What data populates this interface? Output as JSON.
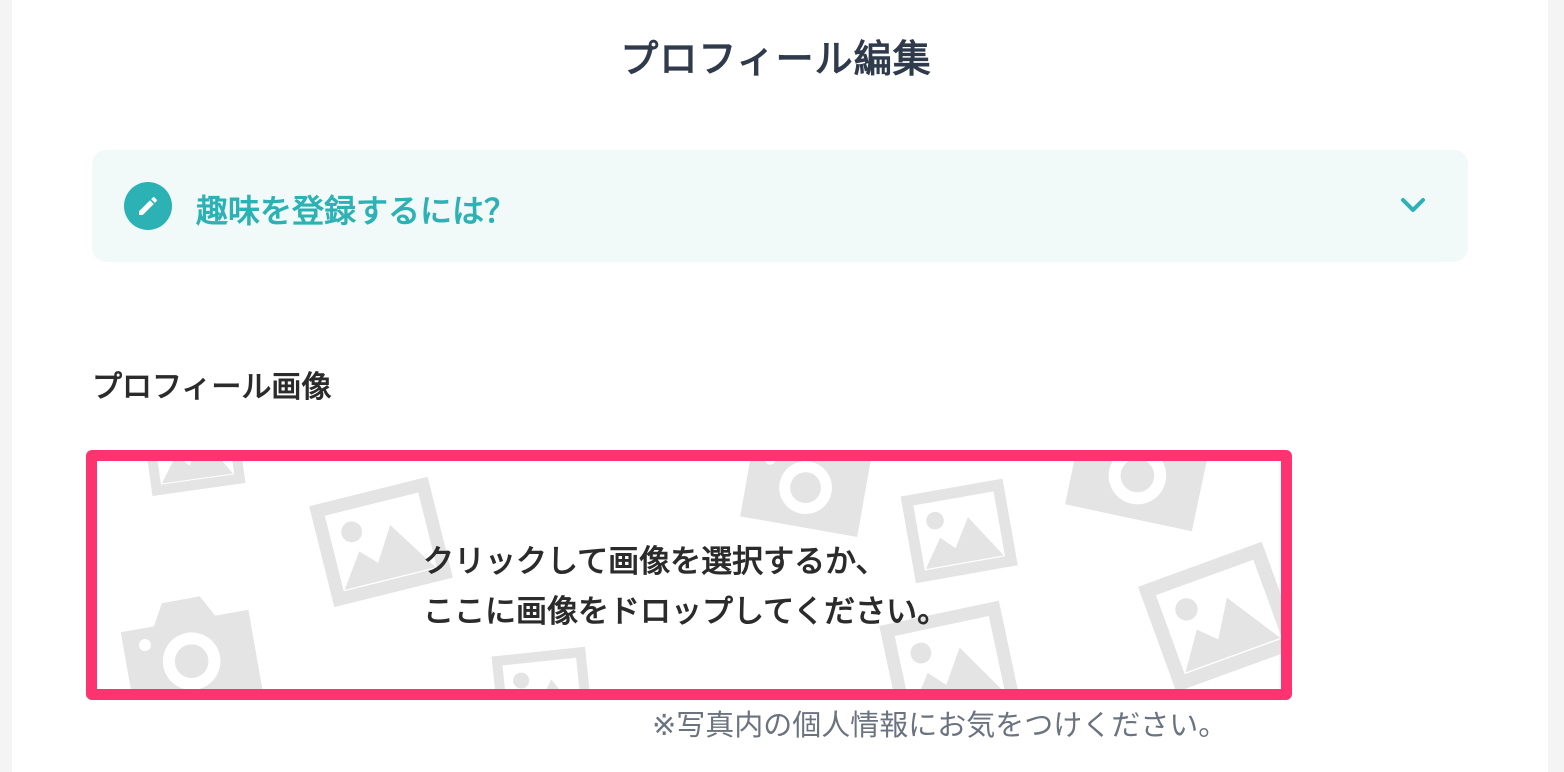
{
  "page": {
    "title": "プロフィール編集"
  },
  "hobby_help": {
    "label": "趣味を登録するには？",
    "icon": "pencil-icon",
    "toggle_icon": "chevron-down-icon",
    "accent_color": "#2cb2b4"
  },
  "profile_image": {
    "section_label": "プロフィール画像",
    "dropzone_line1": "クリックして画像を選択するか、",
    "dropzone_line2": "ここに画像をドロップしてください。",
    "highlight_color": "#ff3370",
    "background_icons": [
      "image-icon",
      "camera-icon"
    ],
    "note": "※写真内の個人情報にお気をつけください。"
  }
}
